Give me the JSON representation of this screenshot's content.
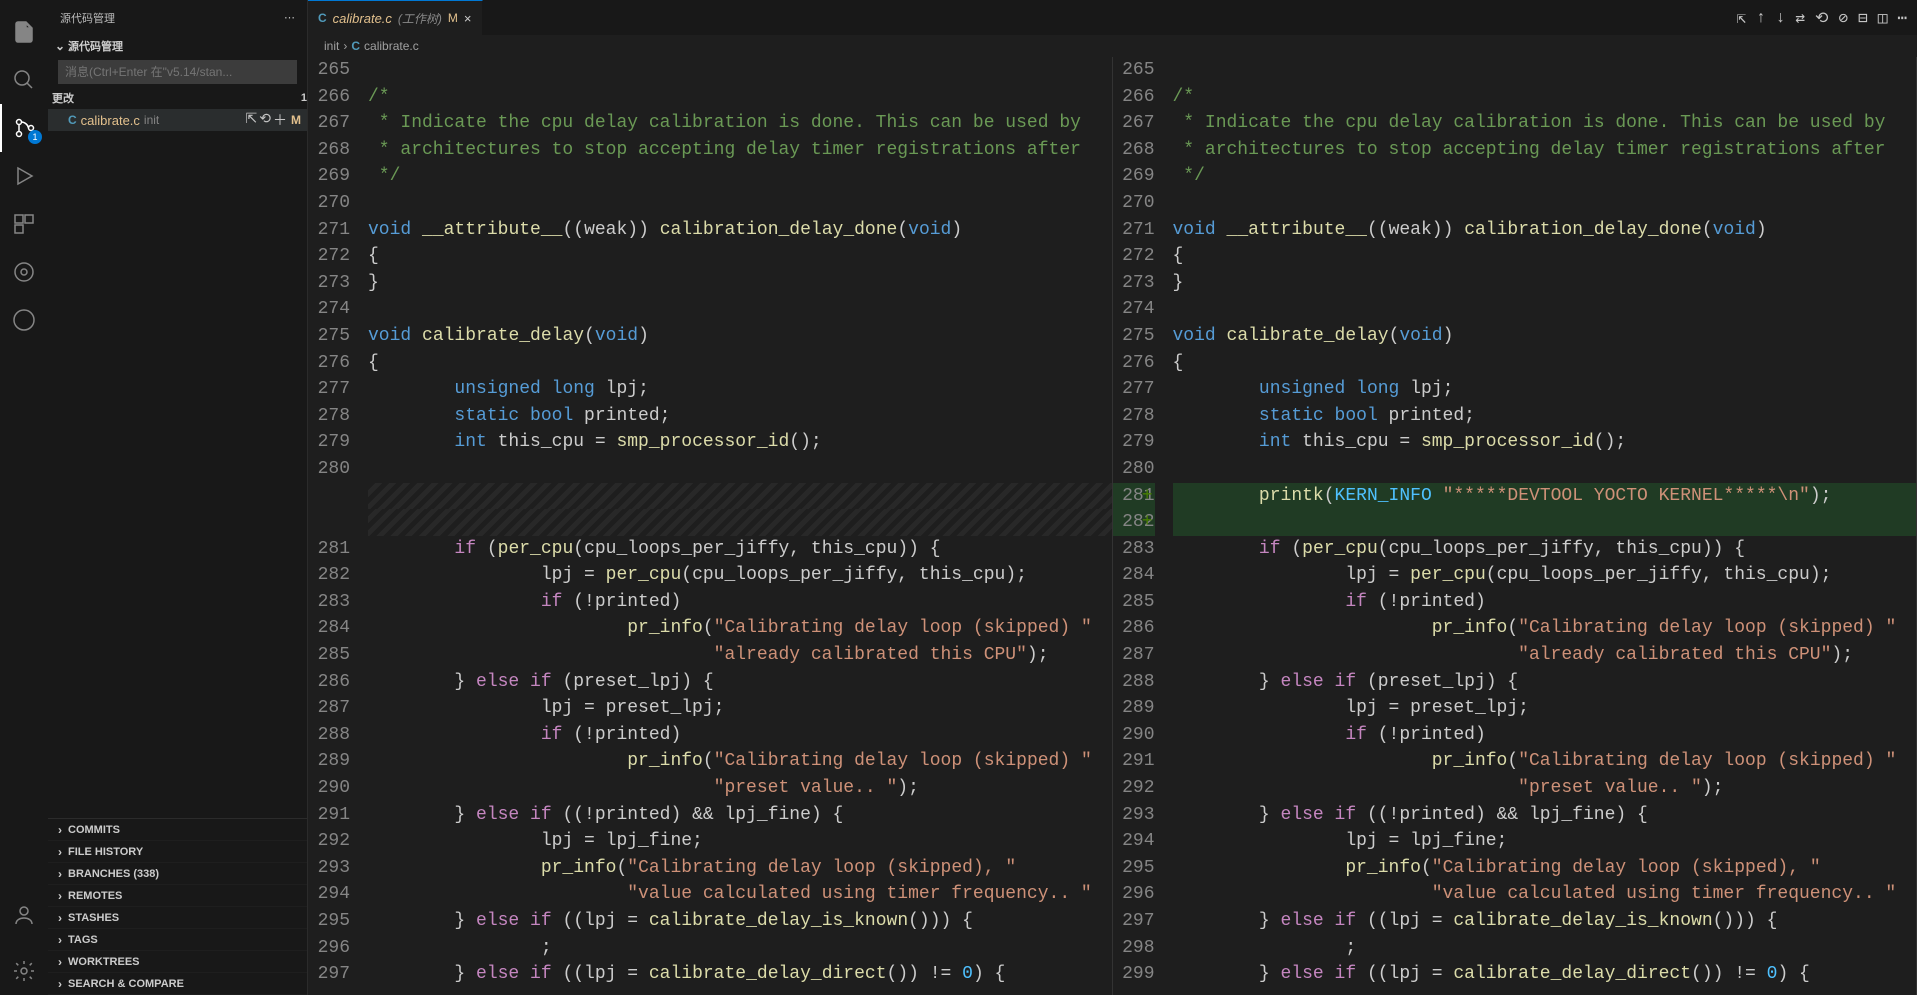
{
  "sidebar": {
    "title": "源代码管理",
    "repo_header": "源代码管理",
    "input_placeholder": "消息(Ctrl+Enter 在\"v5.14/stan...",
    "changes_label": "更改",
    "changes_count": "1",
    "file": {
      "icon": "C",
      "name": "calibrate.c",
      "dir": "init",
      "status": "M"
    },
    "sections": [
      "COMMITS",
      "FILE HISTORY",
      "BRANCHES (338)",
      "REMOTES",
      "STASHES",
      "TAGS",
      "WORKTREES",
      "SEARCH & COMPARE"
    ]
  },
  "tab": {
    "icon": "C",
    "label": "calibrate.c",
    "suffix": "(工作树)",
    "status": "M"
  },
  "breadcrumbs": [
    "init",
    "calibrate.c"
  ],
  "left_lines": [
    {
      "n": "265",
      "t": ""
    },
    {
      "n": "266",
      "t": [
        [
          " ",
          "c-comment",
          "/*"
        ]
      ]
    },
    {
      "n": "267",
      "t": [
        [
          " ",
          "c-comment",
          " * Indicate the cpu delay calibration is done. This can be used by"
        ]
      ]
    },
    {
      "n": "268",
      "t": [
        [
          " ",
          "c-comment",
          " * architectures to stop accepting delay timer registrations after"
        ]
      ]
    },
    {
      "n": "269",
      "t": [
        [
          " ",
          "c-comment",
          " */"
        ]
      ]
    },
    {
      "n": "270",
      "t": ""
    },
    {
      "n": "271",
      "t": [
        [
          "",
          "c-keyword",
          "void"
        ],
        [
          " ",
          "",
          " "
        ],
        [
          "",
          "c-func",
          "__attribute__"
        ],
        [
          "",
          "",
          "((weak)) "
        ],
        [
          "",
          "c-func",
          "calibration_delay_done"
        ],
        [
          "",
          "",
          "("
        ],
        [
          "",
          "c-keyword",
          "void"
        ],
        [
          "",
          "",
          ")"
        ]
      ]
    },
    {
      "n": "272",
      "t": "{"
    },
    {
      "n": "273",
      "t": "}"
    },
    {
      "n": "274",
      "t": ""
    },
    {
      "n": "275",
      "t": [
        [
          "",
          "c-keyword",
          "void"
        ],
        [
          " ",
          "",
          " "
        ],
        [
          "",
          "c-func",
          "calibrate_delay"
        ],
        [
          "",
          "",
          "("
        ],
        [
          "",
          "c-keyword",
          "void"
        ],
        [
          "",
          "",
          ")"
        ]
      ]
    },
    {
      "n": "276",
      "t": "{"
    },
    {
      "n": "277",
      "t": [
        [
          "",
          "",
          "        "
        ],
        [
          "",
          "c-keyword",
          "unsigned long"
        ],
        [
          "",
          "",
          " lpj;"
        ]
      ]
    },
    {
      "n": "278",
      "t": [
        [
          "",
          "",
          "        "
        ],
        [
          "",
          "c-keyword",
          "static bool"
        ],
        [
          "",
          "",
          " printed;"
        ]
      ]
    },
    {
      "n": "279",
      "t": [
        [
          "",
          "",
          "        "
        ],
        [
          "",
          "c-keyword",
          "int"
        ],
        [
          "",
          "",
          " this_cpu = "
        ],
        [
          "",
          "c-func",
          "smp_processor_id"
        ],
        [
          "",
          "",
          "();"
        ]
      ]
    },
    {
      "n": "280",
      "t": ""
    },
    {
      "n": "",
      "t": "",
      "cls": "removed-ph"
    },
    {
      "n": "",
      "t": "",
      "cls": "removed-ph"
    },
    {
      "n": "281",
      "t": [
        [
          "",
          "",
          "        "
        ],
        [
          "",
          "c-macro",
          "if"
        ],
        [
          "",
          "",
          " ("
        ],
        [
          "",
          "c-func",
          "per_cpu"
        ],
        [
          "",
          "",
          "(cpu_loops_per_jiffy, this_cpu)) {"
        ]
      ]
    },
    {
      "n": "282",
      "t": [
        [
          "",
          "",
          "                lpj = "
        ],
        [
          "",
          "c-func",
          "per_cpu"
        ],
        [
          "",
          "",
          "(cpu_loops_per_jiffy, this_cpu);"
        ]
      ]
    },
    {
      "n": "283",
      "t": [
        [
          "",
          "",
          "                "
        ],
        [
          "",
          "c-macro",
          "if"
        ],
        [
          "",
          "",
          " (!printed)"
        ]
      ]
    },
    {
      "n": "284",
      "t": [
        [
          "",
          "",
          "                        "
        ],
        [
          "",
          "c-func",
          "pr_info"
        ],
        [
          "",
          "",
          "("
        ],
        [
          "",
          "c-string",
          "\"Calibrating delay loop (skipped) \""
        ]
      ]
    },
    {
      "n": "285",
      "t": [
        [
          "",
          "",
          "                                "
        ],
        [
          "",
          "c-string",
          "\"already calibrated this CPU\""
        ],
        [
          "",
          "",
          ");"
        ]
      ]
    },
    {
      "n": "286",
      "t": [
        [
          "",
          "",
          "        } "
        ],
        [
          "",
          "c-macro",
          "else if"
        ],
        [
          "",
          "",
          " (preset_lpj) {"
        ]
      ]
    },
    {
      "n": "287",
      "t": "                lpj = preset_lpj;"
    },
    {
      "n": "288",
      "t": [
        [
          "",
          "",
          "                "
        ],
        [
          "",
          "c-macro",
          "if"
        ],
        [
          "",
          "",
          " (!printed)"
        ]
      ]
    },
    {
      "n": "289",
      "t": [
        [
          "",
          "",
          "                        "
        ],
        [
          "",
          "c-func",
          "pr_info"
        ],
        [
          "",
          "",
          "("
        ],
        [
          "",
          "c-string",
          "\"Calibrating delay loop (skipped) \""
        ]
      ]
    },
    {
      "n": "290",
      "t": [
        [
          "",
          "",
          "                                "
        ],
        [
          "",
          "c-string",
          "\"preset value.. \""
        ],
        [
          "",
          "",
          ");"
        ]
      ]
    },
    {
      "n": "291",
      "t": [
        [
          "",
          "",
          "        } "
        ],
        [
          "",
          "c-macro",
          "else if"
        ],
        [
          "",
          "",
          " ((!printed) && lpj_fine) {"
        ]
      ]
    },
    {
      "n": "292",
      "t": "                lpj = lpj_fine;"
    },
    {
      "n": "293",
      "t": [
        [
          "",
          "",
          "                "
        ],
        [
          "",
          "c-func",
          "pr_info"
        ],
        [
          "",
          "",
          "("
        ],
        [
          "",
          "c-string",
          "\"Calibrating delay loop (skipped), \""
        ]
      ]
    },
    {
      "n": "294",
      "t": [
        [
          "",
          "",
          "                        "
        ],
        [
          "",
          "c-string",
          "\"value calculated using timer frequency.. \""
        ]
      ]
    },
    {
      "n": "295",
      "t": [
        [
          "",
          "",
          "        } "
        ],
        [
          "",
          "c-macro",
          "else if"
        ],
        [
          "",
          "",
          " ((lpj = "
        ],
        [
          "",
          "c-func",
          "calibrate_delay_is_known"
        ],
        [
          "",
          "",
          "())) {"
        ]
      ]
    },
    {
      "n": "296",
      "t": "                ;"
    },
    {
      "n": "297",
      "t": [
        [
          "",
          "",
          "        } "
        ],
        [
          "",
          "c-macro",
          "else if"
        ],
        [
          "",
          "",
          " ((lpj = "
        ],
        [
          "",
          "c-func",
          "calibrate_delay_direct"
        ],
        [
          "",
          "",
          "()) != "
        ],
        [
          "",
          "c-const",
          "0"
        ],
        [
          "",
          "",
          ") {"
        ]
      ]
    }
  ],
  "right_lines": [
    {
      "n": "265",
      "t": ""
    },
    {
      "n": "266",
      "t": [
        [
          " ",
          "c-comment",
          "/*"
        ]
      ]
    },
    {
      "n": "267",
      "t": [
        [
          " ",
          "c-comment",
          " * Indicate the cpu delay calibration is done. This can be used by"
        ]
      ]
    },
    {
      "n": "268",
      "t": [
        [
          " ",
          "c-comment",
          " * architectures to stop accepting delay timer registrations after"
        ]
      ]
    },
    {
      "n": "269",
      "t": [
        [
          " ",
          "c-comment",
          " */"
        ]
      ]
    },
    {
      "n": "270",
      "t": ""
    },
    {
      "n": "271",
      "t": [
        [
          "",
          "c-keyword",
          "void"
        ],
        [
          " ",
          "",
          " "
        ],
        [
          "",
          "c-func",
          "__attribute__"
        ],
        [
          "",
          "",
          "((weak)) "
        ],
        [
          "",
          "c-func",
          "calibration_delay_done"
        ],
        [
          "",
          "",
          "("
        ],
        [
          "",
          "c-keyword",
          "void"
        ],
        [
          "",
          "",
          ")"
        ]
      ]
    },
    {
      "n": "272",
      "t": "{"
    },
    {
      "n": "273",
      "t": "}"
    },
    {
      "n": "274",
      "t": ""
    },
    {
      "n": "275",
      "t": [
        [
          "",
          "c-keyword",
          "void"
        ],
        [
          " ",
          "",
          " "
        ],
        [
          "",
          "c-func",
          "calibrate_delay"
        ],
        [
          "",
          "",
          "("
        ],
        [
          "",
          "c-keyword",
          "void"
        ],
        [
          "",
          "",
          ")"
        ]
      ]
    },
    {
      "n": "276",
      "t": "{"
    },
    {
      "n": "277",
      "t": [
        [
          "",
          "",
          "        "
        ],
        [
          "",
          "c-keyword",
          "unsigned long"
        ],
        [
          "",
          "",
          " lpj;"
        ]
      ]
    },
    {
      "n": "278",
      "t": [
        [
          "",
          "",
          "        "
        ],
        [
          "",
          "c-keyword",
          "static bool"
        ],
        [
          "",
          "",
          " printed;"
        ]
      ]
    },
    {
      "n": "279",
      "t": [
        [
          "",
          "",
          "        "
        ],
        [
          "",
          "c-keyword",
          "int"
        ],
        [
          "",
          "",
          " this_cpu = "
        ],
        [
          "",
          "c-func",
          "smp_processor_id"
        ],
        [
          "",
          "",
          "();"
        ]
      ]
    },
    {
      "n": "280",
      "t": ""
    },
    {
      "n": "281",
      "cls": "added",
      "plus": true,
      "t": [
        [
          "",
          "",
          "        "
        ],
        [
          "",
          "c-func",
          "printk"
        ],
        [
          "",
          "",
          "("
        ],
        [
          "",
          "c-const",
          "KERN_INFO"
        ],
        [
          "",
          "",
          " "
        ],
        [
          "",
          "c-string",
          "\"*****DEVTOOL YOCTO KERNEL*****\\n\""
        ],
        [
          "",
          "",
          ");"
        ]
      ]
    },
    {
      "n": "282",
      "cls": "added",
      "plus": true,
      "t": ""
    },
    {
      "n": "283",
      "t": [
        [
          "",
          "",
          "        "
        ],
        [
          "",
          "c-macro",
          "if"
        ],
        [
          "",
          "",
          " ("
        ],
        [
          "",
          "c-func",
          "per_cpu"
        ],
        [
          "",
          "",
          "(cpu_loops_per_jiffy, this_cpu)) {"
        ]
      ]
    },
    {
      "n": "284",
      "t": [
        [
          "",
          "",
          "                lpj = "
        ],
        [
          "",
          "c-func",
          "per_cpu"
        ],
        [
          "",
          "",
          "(cpu_loops_per_jiffy, this_cpu);"
        ]
      ]
    },
    {
      "n": "285",
      "t": [
        [
          "",
          "",
          "                "
        ],
        [
          "",
          "c-macro",
          "if"
        ],
        [
          "",
          "",
          " (!printed)"
        ]
      ]
    },
    {
      "n": "286",
      "t": [
        [
          "",
          "",
          "                        "
        ],
        [
          "",
          "c-func",
          "pr_info"
        ],
        [
          "",
          "",
          "("
        ],
        [
          "",
          "c-string",
          "\"Calibrating delay loop (skipped) \""
        ]
      ]
    },
    {
      "n": "287",
      "t": [
        [
          "",
          "",
          "                                "
        ],
        [
          "",
          "c-string",
          "\"already calibrated this CPU\""
        ],
        [
          "",
          "",
          ");"
        ]
      ]
    },
    {
      "n": "288",
      "t": [
        [
          "",
          "",
          "        } "
        ],
        [
          "",
          "c-macro",
          "else if"
        ],
        [
          "",
          "",
          " (preset_lpj) {"
        ]
      ]
    },
    {
      "n": "289",
      "t": "                lpj = preset_lpj;"
    },
    {
      "n": "290",
      "t": [
        [
          "",
          "",
          "                "
        ],
        [
          "",
          "c-macro",
          "if"
        ],
        [
          "",
          "",
          " (!printed)"
        ]
      ]
    },
    {
      "n": "291",
      "t": [
        [
          "",
          "",
          "                        "
        ],
        [
          "",
          "c-func",
          "pr_info"
        ],
        [
          "",
          "",
          "("
        ],
        [
          "",
          "c-string",
          "\"Calibrating delay loop (skipped) \""
        ]
      ]
    },
    {
      "n": "292",
      "t": [
        [
          "",
          "",
          "                                "
        ],
        [
          "",
          "c-string",
          "\"preset value.. \""
        ],
        [
          "",
          "",
          ");"
        ]
      ]
    },
    {
      "n": "293",
      "t": [
        [
          "",
          "",
          "        } "
        ],
        [
          "",
          "c-macro",
          "else if"
        ],
        [
          "",
          "",
          " ((!printed) && lpj_fine) {"
        ]
      ]
    },
    {
      "n": "294",
      "t": "                lpj = lpj_fine;"
    },
    {
      "n": "295",
      "t": [
        [
          "",
          "",
          "                "
        ],
        [
          "",
          "c-func",
          "pr_info"
        ],
        [
          "",
          "",
          "("
        ],
        [
          "",
          "c-string",
          "\"Calibrating delay loop (skipped), \""
        ]
      ]
    },
    {
      "n": "296",
      "t": [
        [
          "",
          "",
          "                        "
        ],
        [
          "",
          "c-string",
          "\"value calculated using timer frequency.. \""
        ]
      ]
    },
    {
      "n": "297",
      "t": [
        [
          "",
          "",
          "        } "
        ],
        [
          "",
          "c-macro",
          "else if"
        ],
        [
          "",
          "",
          " ((lpj = "
        ],
        [
          "",
          "c-func",
          "calibrate_delay_is_known"
        ],
        [
          "",
          "",
          "())) {"
        ]
      ]
    },
    {
      "n": "298",
      "t": "                ;"
    },
    {
      "n": "299",
      "t": [
        [
          "",
          "",
          "        } "
        ],
        [
          "",
          "c-macro",
          "else if"
        ],
        [
          "",
          "",
          " ((lpj = "
        ],
        [
          "",
          "c-func",
          "calibrate_delay_direct"
        ],
        [
          "",
          "",
          "()) != "
        ],
        [
          "",
          "c-const",
          "0"
        ],
        [
          "",
          "",
          ") {"
        ]
      ]
    }
  ]
}
